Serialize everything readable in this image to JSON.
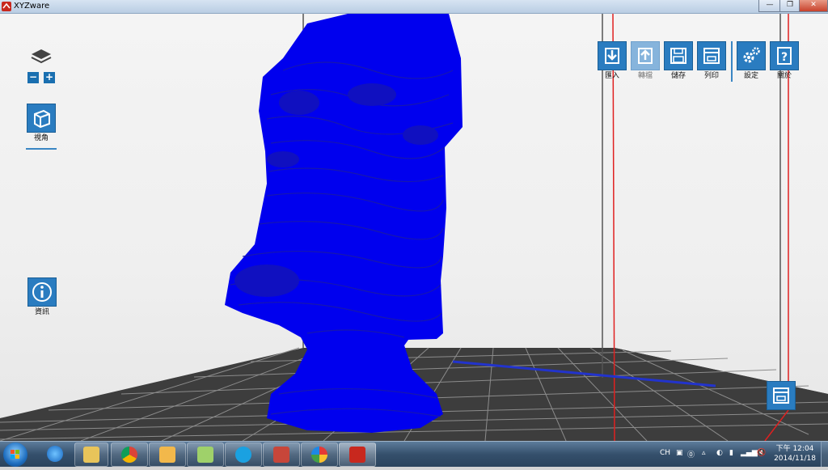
{
  "window": {
    "title": "XYZware",
    "min_symbol": "—",
    "max_symbol": "❐",
    "close_symbol": "✕"
  },
  "left_toolbar": {
    "layers_icon": "layers-icon",
    "zoom_out": "−",
    "zoom_in": "+",
    "view_label": "視角",
    "info_label": "資訊"
  },
  "main_toolbar": {
    "import_label": "匯入",
    "export_label": "轉檔",
    "save_label": "儲存",
    "print_label": "列印",
    "settings_label": "設定",
    "about_label": "關於"
  },
  "colors": {
    "model": "#0000ee",
    "accent": "#2a7cc0",
    "boundary": "#e02020"
  },
  "taskbar": {
    "apps": [
      "internet-explorer",
      "file-explorer",
      "chrome",
      "outlook",
      "folder",
      "skype",
      "xyzware-alt",
      "paint",
      "xyzware"
    ],
    "lang": "CH",
    "time": "下午 12:04",
    "date": "2014/11/18"
  }
}
